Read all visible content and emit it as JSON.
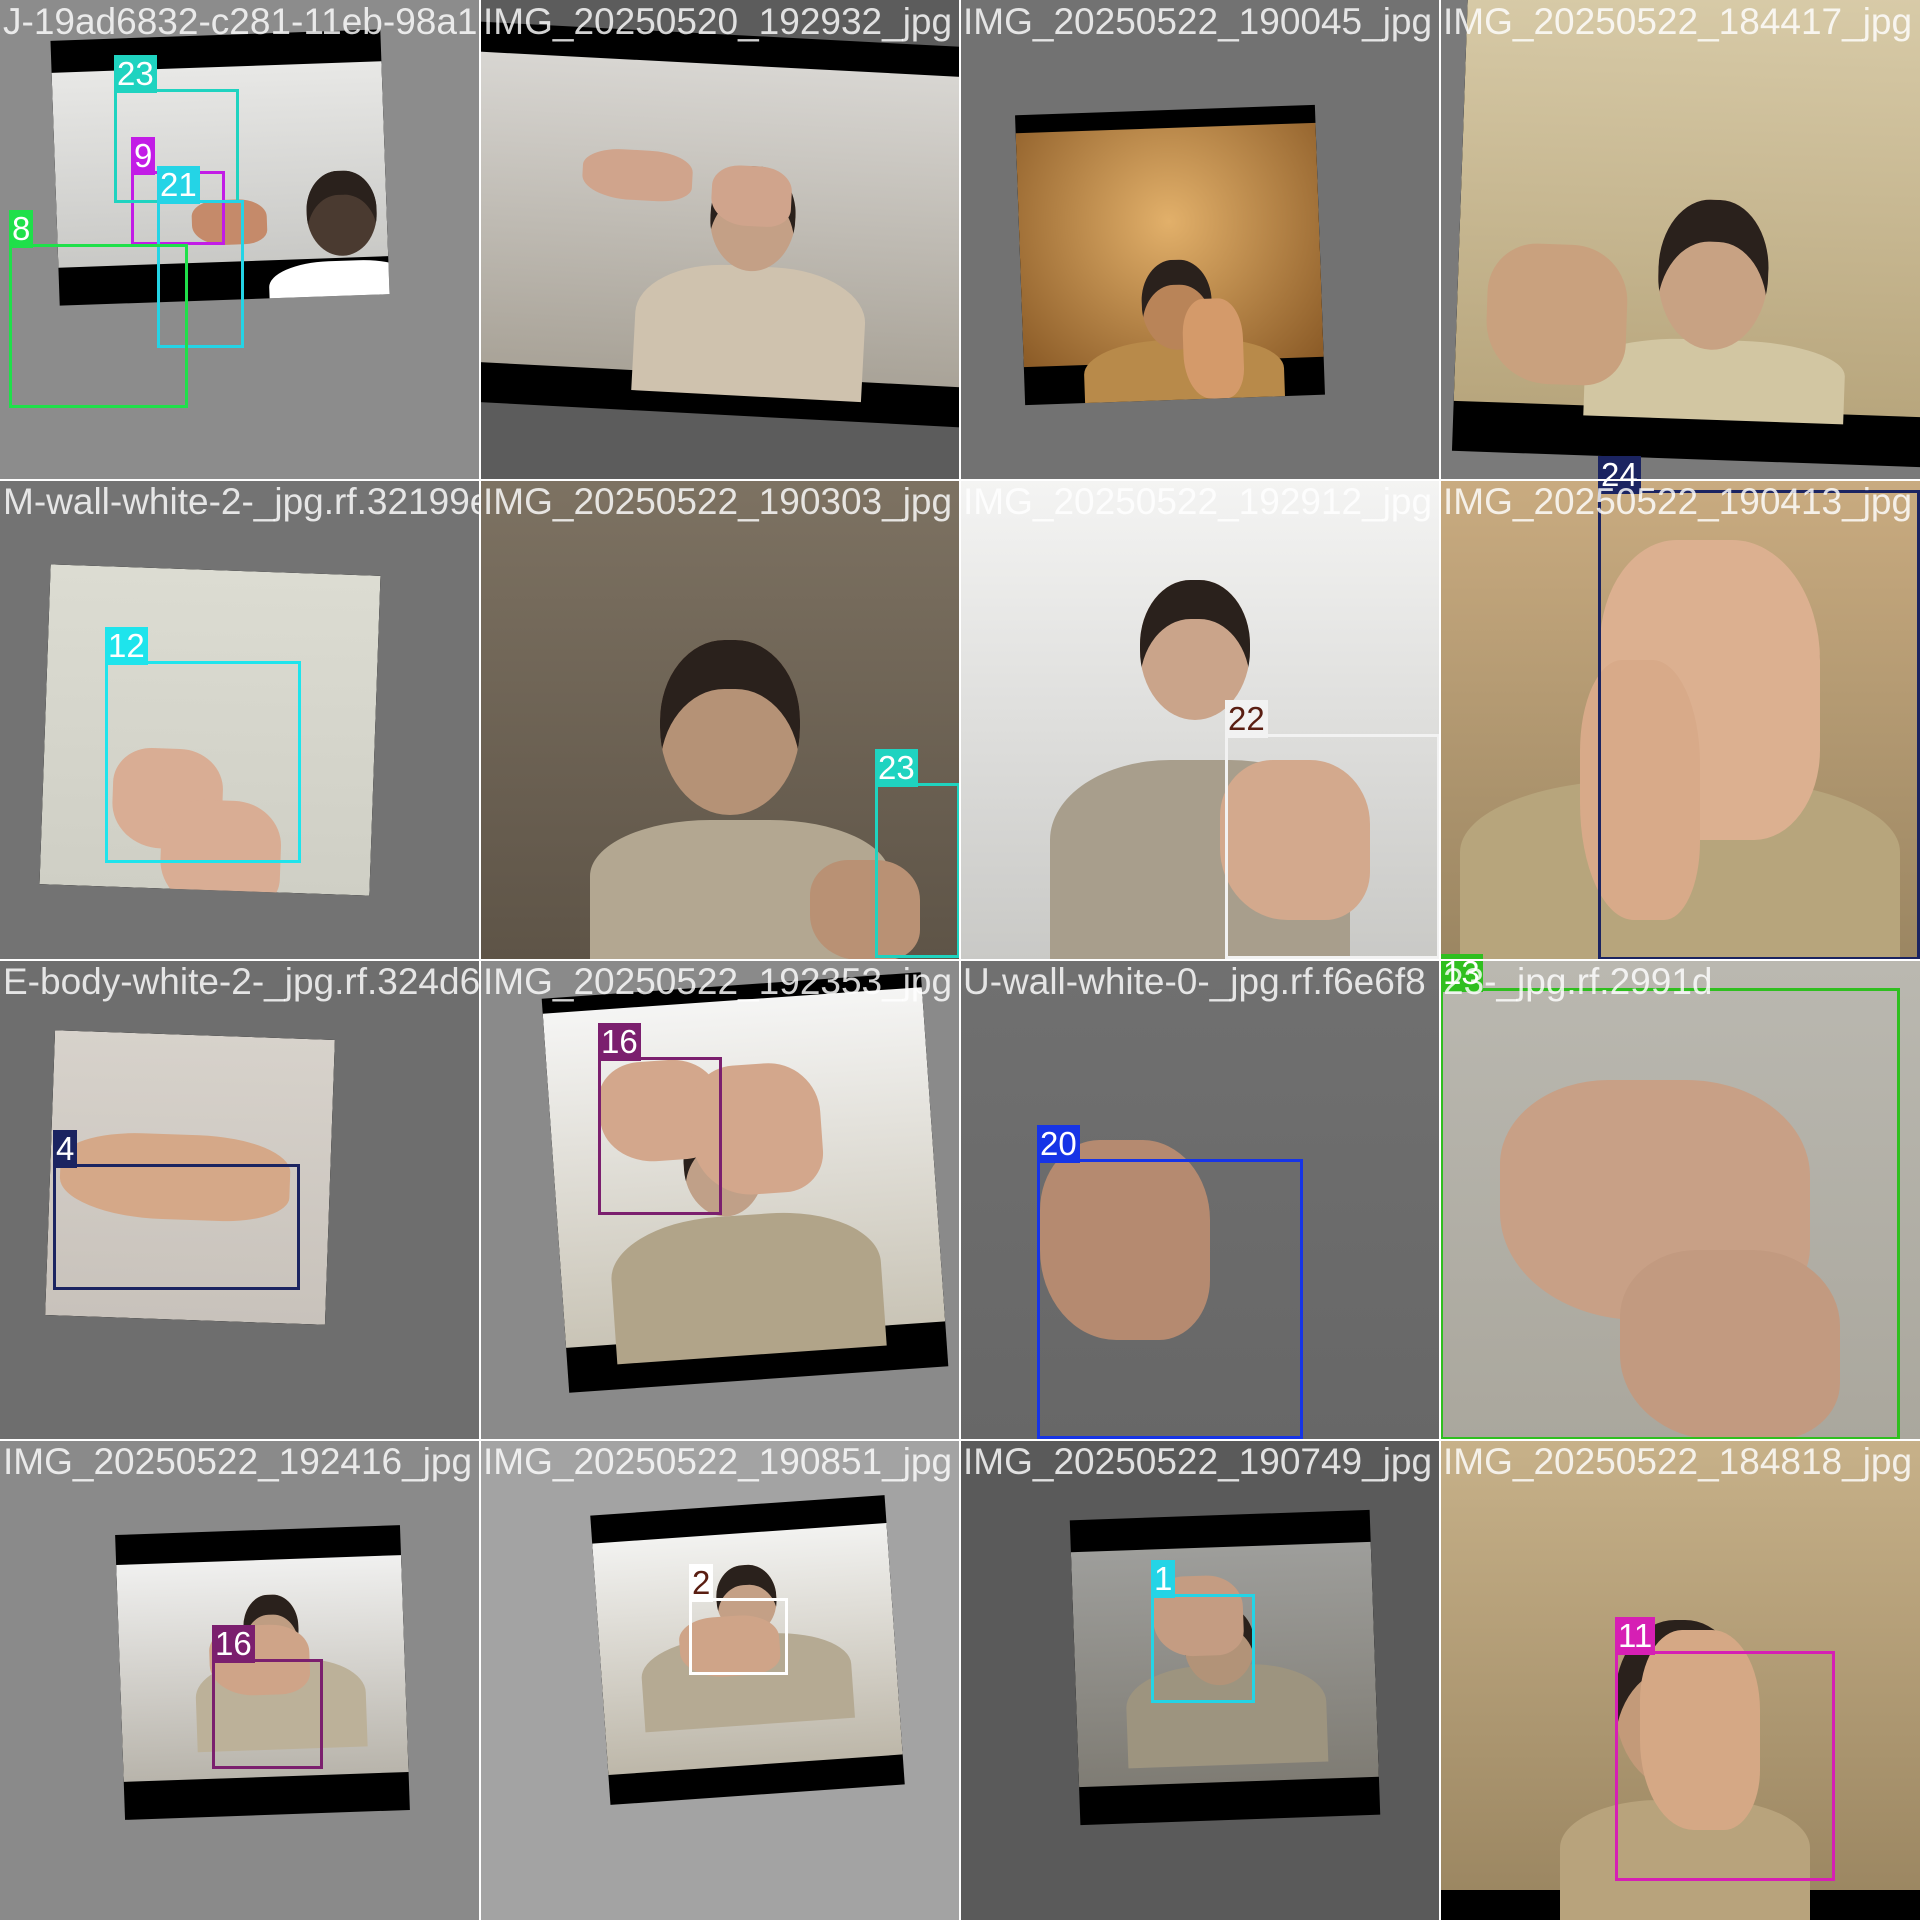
{
  "mosaic": {
    "tiles": [
      {
        "filename": "J-19ad6832-c281-11eb-98a1-00d8fb6f6530_jpg",
        "background": "#8c8c8c",
        "labels": [
          {
            "text": "9",
            "color": "#c21ce6",
            "text_color": "#ffffff"
          }
        ]
      },
      {
        "filename": "IMG_20250520_192932_jpg",
        "background": "#5c5c5c",
        "labels": [
          {
            "text": "23",
            "color": "#1fd3c0",
            "text_color": "#ffffff"
          }
        ]
      },
      {
        "filename": "IMG_20250522_190045_jpg",
        "background": "#727272",
        "labels": [
          {
            "text": "21",
            "color": "#24d4e6",
            "text_color": "#ffffff"
          }
        ]
      },
      {
        "filename": "IMG_20250522_184417_jpg",
        "background": "#7a7a7a",
        "labels": [
          {
            "text": "8",
            "color": "#1fe04a",
            "text_color": "#ffffff"
          }
        ]
      },
      {
        "filename": "M-wall-white-2-_jpg.rf.32199e04",
        "background": "#737373",
        "labels": [
          {
            "text": "12",
            "color": "#1ee4ec",
            "text_color": "#ffffff"
          }
        ]
      },
      {
        "filename": "IMG_20250522_190303_jpg",
        "background": "#7a6f60",
        "labels": [
          {
            "text": "23",
            "color": "#1fd3c0",
            "text_color": "#ffffff"
          }
        ]
      },
      {
        "filename": "IMG_20250522_192912_jpg",
        "background": "#dcdcda",
        "labels": [
          {
            "text": "22",
            "color": "#f2f2f2",
            "text_color": "#5a1e12"
          }
        ]
      },
      {
        "filename": "IMG_20250522_190413_jpg",
        "background": "#8f7a5c",
        "labels": [
          {
            "text": "24",
            "color": "#1b2461",
            "text_color": "#ffffff"
          }
        ]
      },
      {
        "filename": "E-body-white-2-_jpg.rf.324d6",
        "background": "#6e6e6e",
        "labels": [
          {
            "text": "4",
            "color": "#1b2461",
            "text_color": "#ffffff"
          }
        ]
      },
      {
        "filename": "IMG_20250522_192353_jpg",
        "background": "#8a8a8a",
        "labels": [
          {
            "text": "16",
            "color": "#7b1f6e",
            "text_color": "#ffffff"
          }
        ]
      },
      {
        "filename": "U-wall-white-0-_jpg.rf.f6e6f8",
        "background": "#6b6b6b",
        "labels": [
          {
            "text": "20",
            "color": "#1634e6",
            "text_color": "#ffffff"
          }
        ]
      },
      {
        "filename": "23-_jpg.rf.2991d",
        "background": "#b8b6ae",
        "labels": [
          {
            "text": "13",
            "color": "#2fbf1f",
            "text_color": "#ffffff"
          }
        ]
      },
      {
        "filename": "IMG_20250522_192416_jpg",
        "background": "#8a8a8a",
        "labels": [
          {
            "text": "16",
            "color": "#7b1f6e",
            "text_color": "#ffffff"
          }
        ]
      },
      {
        "filename": "IMG_20250522_190851_jpg",
        "background": "#a3a3a3",
        "labels": [
          {
            "text": "2",
            "color": "#ffffff",
            "text_color": "#5a1e12"
          }
        ]
      },
      {
        "filename": "IMG_20250522_190749_jpg",
        "background": "#5a5a5a",
        "labels": [
          {
            "text": "1",
            "color": "#24d4e6",
            "text_color": "#ffffff"
          }
        ]
      },
      {
        "filename": "IMG_20250522_184818_jpg",
        "background": "#a08f70",
        "labels": [
          {
            "text": "11",
            "color": "#d61fb4",
            "text_color": "#ffffff"
          }
        ]
      }
    ]
  }
}
